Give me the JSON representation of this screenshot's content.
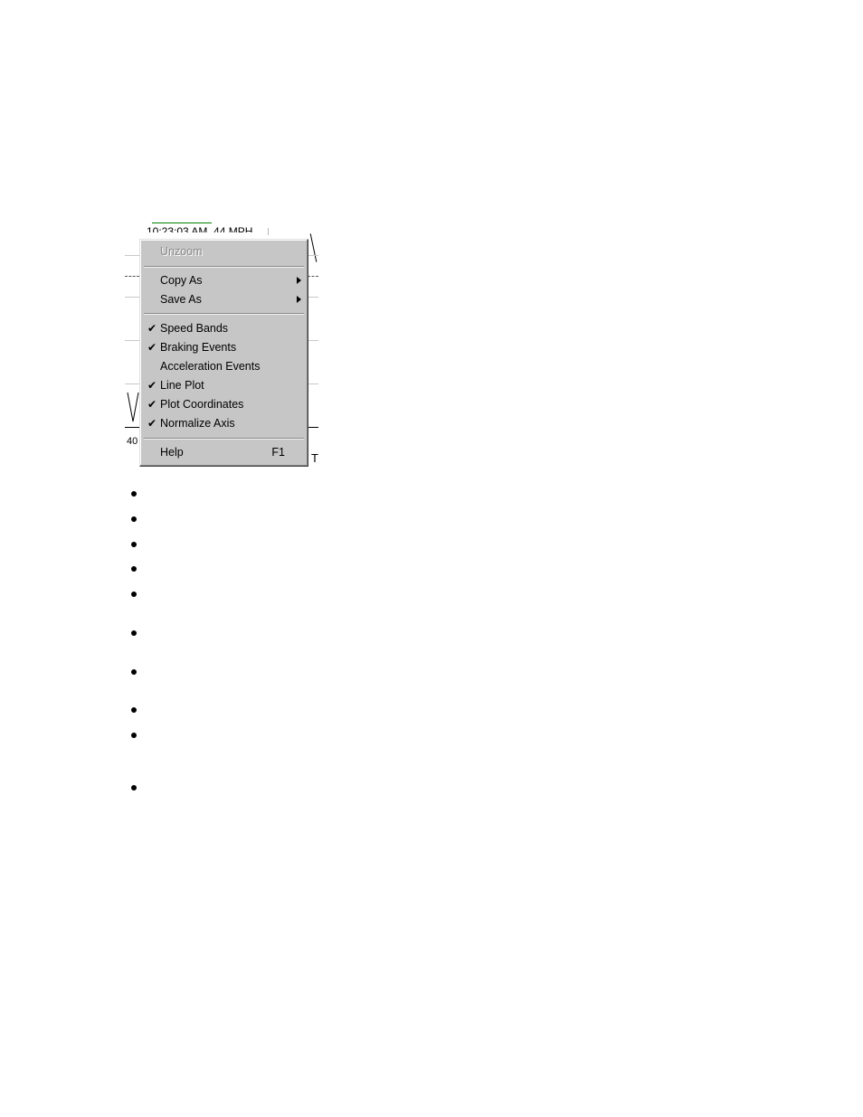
{
  "chart_fragment": {
    "coordinate_readout": "10:23:03 AM, 44 MPH",
    "axis_tick_label": "40",
    "axis_partial_label": "T"
  },
  "context_menu": {
    "items": [
      {
        "label": "Unzoom",
        "checked": false,
        "enabled": false,
        "submenu": false,
        "accel": ""
      },
      {
        "separator": true
      },
      {
        "label": "Copy As",
        "checked": false,
        "enabled": true,
        "submenu": true,
        "accel": ""
      },
      {
        "label": "Save As",
        "checked": false,
        "enabled": true,
        "submenu": true,
        "accel": ""
      },
      {
        "separator": true
      },
      {
        "label": "Speed Bands",
        "checked": true,
        "enabled": true,
        "submenu": false,
        "accel": ""
      },
      {
        "label": "Braking Events",
        "checked": true,
        "enabled": true,
        "submenu": false,
        "accel": ""
      },
      {
        "label": "Acceleration Events",
        "checked": false,
        "enabled": true,
        "submenu": false,
        "accel": ""
      },
      {
        "label": "Line Plot",
        "checked": true,
        "enabled": true,
        "submenu": false,
        "accel": ""
      },
      {
        "label": "Plot Coordinates",
        "checked": true,
        "enabled": true,
        "submenu": false,
        "accel": ""
      },
      {
        "label": "Normalize Axis",
        "checked": true,
        "enabled": true,
        "submenu": false,
        "accel": ""
      },
      {
        "separator": true
      },
      {
        "label": "Help",
        "checked": false,
        "enabled": true,
        "submenu": false,
        "accel": "F1"
      }
    ],
    "check_glyph": "✔"
  },
  "bullet_list": {
    "count": 10
  }
}
